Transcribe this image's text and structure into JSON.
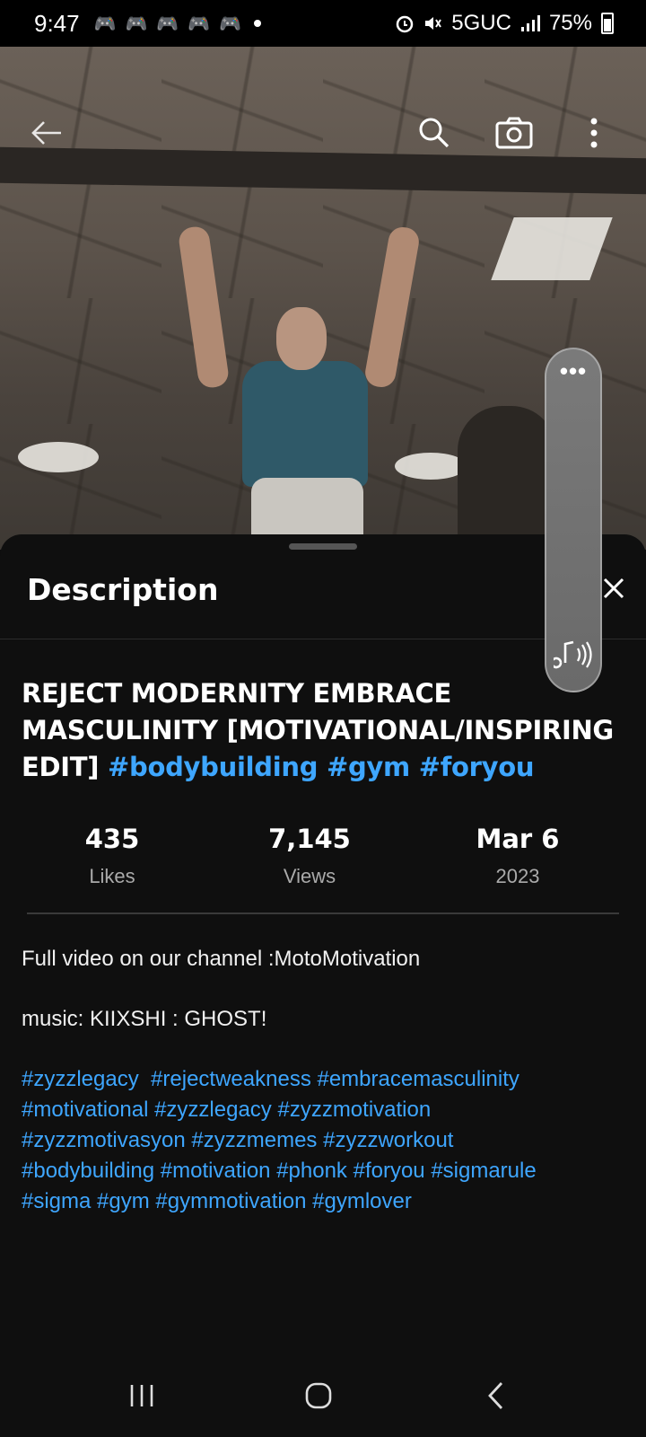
{
  "status_bar": {
    "time": "9:47",
    "network": "5GUC",
    "battery": "75%",
    "notification_icons": [
      "gamepad-icon",
      "gamepad-icon",
      "gamepad-icon",
      "gamepad-icon",
      "gamepad-icon"
    ]
  },
  "video_controls": {
    "back_icon": "arrow-left-icon",
    "search_icon": "search-icon",
    "camera_icon": "camera-icon",
    "more_icon": "more-vertical-icon"
  },
  "floating_media": {
    "more_icon": "more-horizontal-icon",
    "music_icon": "music-sound-icon"
  },
  "sheet": {
    "title": "Description",
    "close_icon": "close-icon"
  },
  "video": {
    "title_text": "REJECT MODERNITY EMBRACE MASCULINITY [MOTIVATIONAL/INSPIRING EDIT] ",
    "title_tags": "#bodybuilding #gym #foryou"
  },
  "stats": [
    {
      "value": "435",
      "label": "Likes"
    },
    {
      "value": "7,145",
      "label": "Views"
    },
    {
      "value": "Mar 6",
      "label": "2023"
    }
  ],
  "description": {
    "line1": "Full video on our channel :MotoMotivation",
    "line2": "music: KIIXSHI : GHOST!",
    "hashtags": [
      "#zyzzlegacy  #rejectweakness #embracemasculinity",
      "#motivational #zyzzlegacy #zyzzmotivation",
      "#zyzzmotivasyon #zyzzmemes #zyzzworkout",
      "#bodybuilding #motivation #phonk #foryou #sigmarule",
      "#sigma #gym #gymmotivation #gymlover"
    ]
  },
  "nav_bar": {
    "recents_icon": "recents-icon",
    "home_icon": "home-icon",
    "back_icon": "back-chevron-icon"
  },
  "colors": {
    "background": "#0f0f0f",
    "link": "#3ea6ff",
    "secondary_text": "#aaaaaa"
  }
}
